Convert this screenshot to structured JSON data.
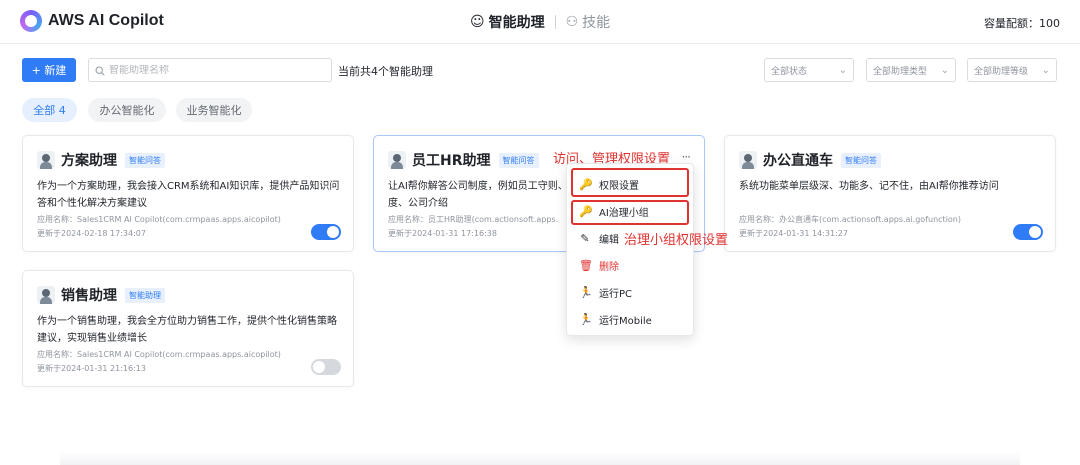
{
  "header": {
    "app_title": "AWS AI Copilot",
    "nav_active": "智能助理",
    "nav_inactive": "技能",
    "capacity": "容量配额：100"
  },
  "toolbar": {
    "new_label": "+ 新建",
    "search_placeholder": "智能助理名称",
    "count_text": "当前共4个智能助理",
    "filters": [
      "全部状态",
      "全部助理类型",
      "全部助理等级"
    ]
  },
  "tabs": [
    {
      "label": "全部 4",
      "active": true
    },
    {
      "label": "办公智能化",
      "active": false
    },
    {
      "label": "业务智能化",
      "active": false
    }
  ],
  "cards": [
    {
      "title": "方案助理",
      "tag": "智能问答",
      "desc": "作为一个方案助理，我会接入CRM系统和AI知识库，提供产品知识问答和个性化解决方案建议",
      "app_name": "应用名称：Sales1CRM AI Copilot(com.crmpaas.apps.aicopilot)",
      "updated": "更新于2024-02-18 17:34:07",
      "enabled": true
    },
    {
      "title": "员工HR助理",
      "tag": "智能问答",
      "desc": "让AI帮你解答公司制度，例如员工守则、度、公司介绍",
      "app_name": "应用名称：员工HR助理(com.actionsoft.apps.",
      "updated": "更新于2024-01-31 17:16:38",
      "more": "···"
    },
    {
      "title": "办公直通车",
      "tag": "智能问答",
      "desc": "系统功能菜单层级深、功能多、记不住，由AI帮你推荐访问",
      "app_name": "应用名称：办公直通车(com.actionsoft.apps.ai.gofunction)",
      "updated": "更新于2024-01-31 14:31:27",
      "enabled": true
    },
    {
      "title": "销售助理",
      "tag": "智能助理",
      "desc": "作为一个销售助理，我会全方位助力销售工作，提供个性化销售策略建议，实现销售业绩增长",
      "app_name": "应用名称：Sales1CRM AI Copilot(com.crmpaas.apps.aicopilot)",
      "updated": "更新于2024-01-31 21:16:13",
      "enabled": false
    }
  ],
  "menu": {
    "items": [
      {
        "label": "权限设置",
        "icon": "key-icon",
        "glyph": "🔑"
      },
      {
        "label": "AI治理小组",
        "icon": "key-icon",
        "glyph": "🔑"
      },
      {
        "label": "编辑",
        "icon": "edit-icon",
        "glyph": "✎"
      },
      {
        "label": "删除",
        "icon": "trash-icon",
        "glyph": "🗑"
      },
      {
        "label": "运行PC",
        "icon": "run-icon",
        "glyph": "🏃"
      },
      {
        "label": "运行Mobile",
        "icon": "run-icon",
        "glyph": "🏃"
      }
    ]
  },
  "annotations": {
    "access": "访问、管理权限设置",
    "governance": "治理小组权限设置"
  },
  "colors": {
    "primary": "#2f7cf6",
    "annotation": "#e0322f"
  }
}
